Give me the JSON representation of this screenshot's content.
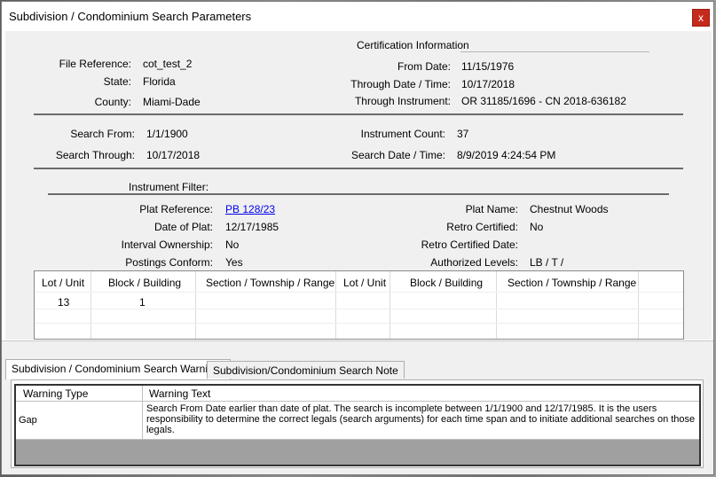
{
  "window": {
    "title": "Subdivision / Condominium Search Parameters",
    "close_label": "x"
  },
  "cert": {
    "heading": "Certification Information",
    "from_date_label": "From Date:",
    "from_date": "11/15/1976",
    "through_date_label": "Through Date / Time:",
    "through_date": "10/17/2018",
    "through_instr_label": "Through Instrument:",
    "through_instr": "OR 31185/1696 - CN 2018-636182"
  },
  "file": {
    "file_ref_label": "File Reference:",
    "file_ref": "cot_test_2",
    "state_label": "State:",
    "state": "Florida",
    "county_label": "County:",
    "county": "Miami-Dade"
  },
  "search": {
    "from_label": "Search From:",
    "from": "1/1/1900",
    "through_label": "Search Through:",
    "through": "10/17/2018",
    "count_label": "Instrument Count:",
    "count": "37",
    "date_label": "Search Date / Time:",
    "date": "8/9/2019 4:24:54 PM"
  },
  "filter": {
    "heading": "Instrument Filter:",
    "plat_ref_label": "Plat Reference:",
    "plat_ref": "PB 128/23",
    "date_plat_label": "Date of Plat:",
    "date_plat": "12/17/1985",
    "interval_label": "Interval Ownership:",
    "interval": "No",
    "postings_label": "Postings Conform:",
    "postings": "Yes",
    "plat_name_label": "Plat Name:",
    "plat_name": "Chestnut Woods",
    "retro_label": "Retro Certified:",
    "retro": "No",
    "retro_date_label": "Retro Certified Date:",
    "retro_date": "",
    "auth_label": "Authorized Levels:",
    "auth": "LB / T /"
  },
  "grid": {
    "headers": [
      "Lot / Unit",
      "Block / Building",
      "Section / Township / Range",
      "Lot / Unit",
      "Block / Building",
      "Section / Township / Range"
    ],
    "row": [
      "13",
      "1",
      "",
      "",
      "",
      ""
    ]
  },
  "tabs": [
    "Subdivision / Condominium Search Warnings",
    "Subdivision/Condominium Search Note"
  ],
  "warnings": {
    "col_type": "Warning Type",
    "col_text": "Warning Text",
    "rows": [
      {
        "type": "Gap",
        "text": "Search From Date earlier than date of plat.  The search is incomplete between 1/1/1900 and 12/17/1985.  It is the users responsibility to determine the correct legals (search arguments) for each time span and to initiate additional searches on those legals."
      }
    ]
  }
}
